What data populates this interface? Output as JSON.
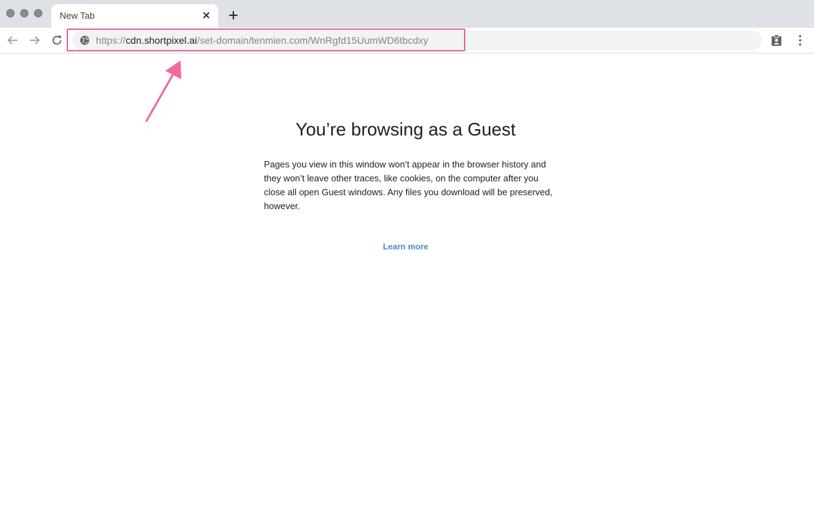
{
  "tab": {
    "title": "New Tab"
  },
  "omnibox": {
    "scheme": "https://",
    "host": "cdn.shortpixel.ai",
    "path": "/set-domain/tenmien.com/WnRgfd15UumWD6tbcdxy"
  },
  "content": {
    "heading": "You’re browsing as a Guest",
    "description": "Pages you view in this window won’t appear in the browser history and they won’t leave other traces, like cookies, on the computer after you close all open Guest windows. Any files you download will be preserved, however.",
    "learn_more": "Learn more"
  },
  "colors": {
    "highlight": "#e8679b",
    "link": "#4a86d4",
    "tabstrip": "#dee1e6"
  },
  "icons": [
    "globe-icon",
    "back-arrow-icon",
    "forward-arrow-icon",
    "reload-icon",
    "close-icon",
    "plus-icon",
    "clipboard-person-icon",
    "kebab-menu-icon",
    "annotation-arrow-icon"
  ]
}
